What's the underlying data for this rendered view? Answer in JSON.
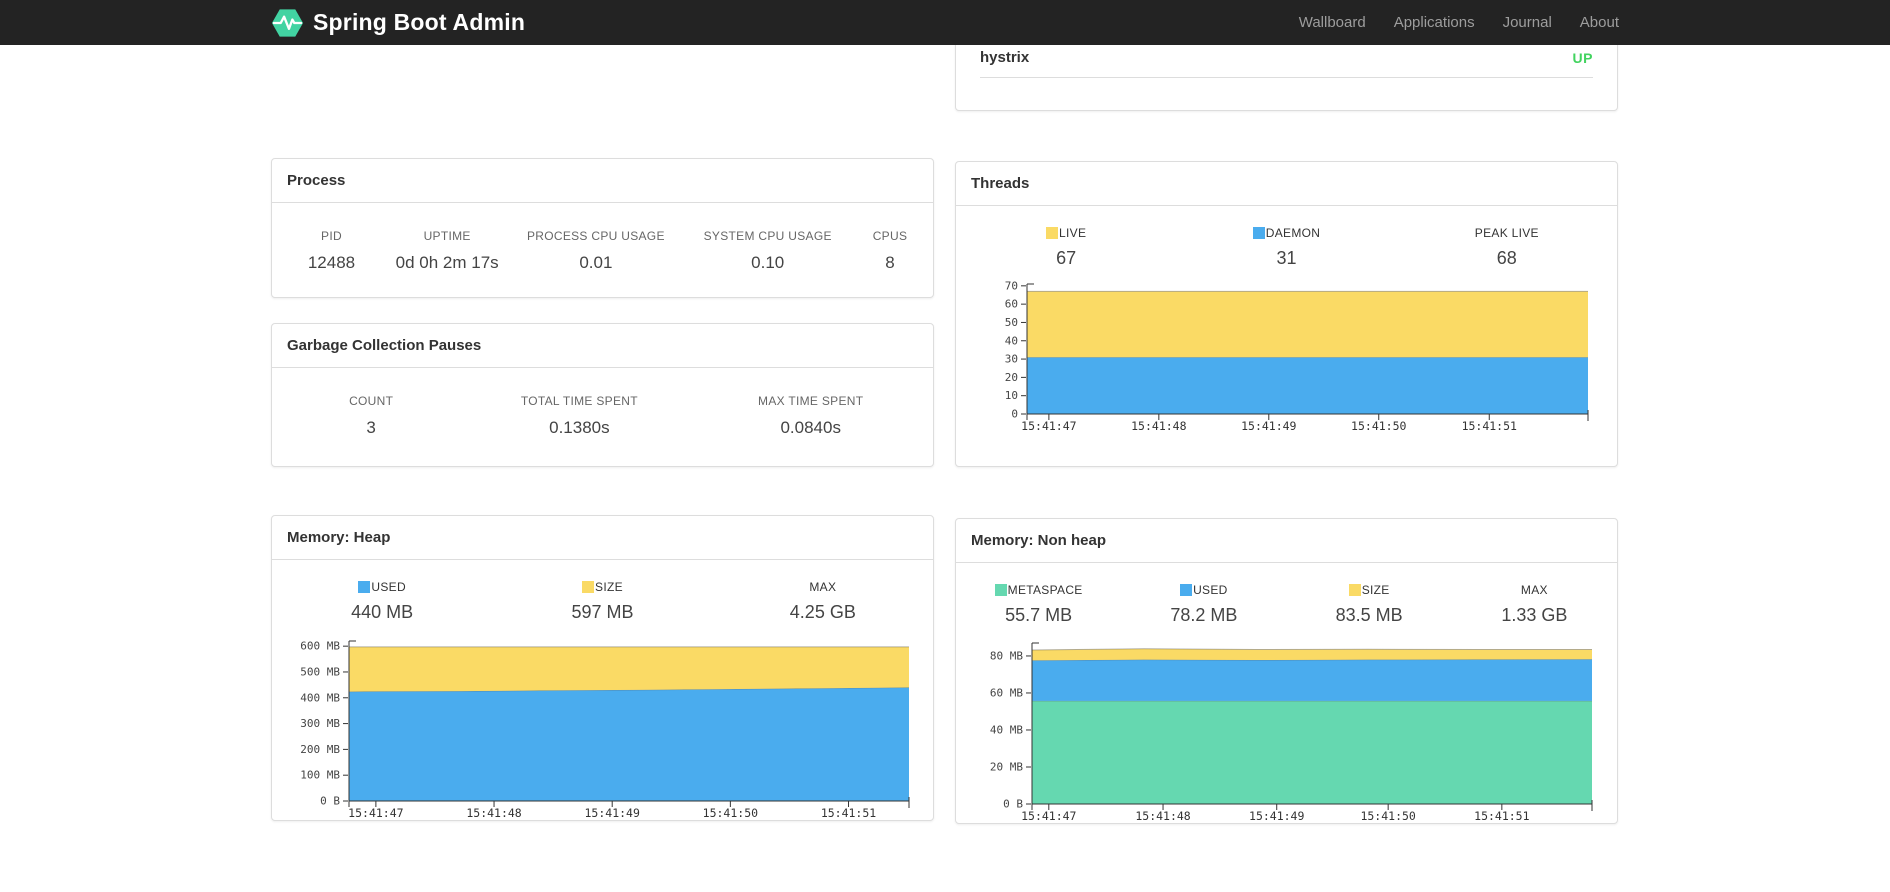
{
  "navbar": {
    "brand": "Spring Boot Admin",
    "links": [
      {
        "label": "Wallboard"
      },
      {
        "label": "Applications"
      },
      {
        "label": "Journal"
      },
      {
        "label": "About"
      }
    ]
  },
  "colors": {
    "navbar_bg": "#232323",
    "brand_green": "#42d3a2",
    "status_up": "#42d35f",
    "chart_yellow": "#fada65",
    "chart_blue": "#4aacee",
    "chart_green": "#65d8b0"
  },
  "application": {
    "name": "hystrix",
    "status": "UP"
  },
  "process": {
    "title": "Process",
    "metrics": [
      {
        "label": "PID",
        "value": "12488"
      },
      {
        "label": "UPTIME",
        "value": "0d 0h 2m 17s"
      },
      {
        "label": "PROCESS CPU USAGE",
        "value": "0.01"
      },
      {
        "label": "SYSTEM CPU USAGE",
        "value": "0.10"
      },
      {
        "label": "CPUS",
        "value": "8"
      }
    ]
  },
  "gc": {
    "title": "Garbage Collection Pauses",
    "metrics": [
      {
        "label": "COUNT",
        "value": "3"
      },
      {
        "label": "TOTAL TIME SPENT",
        "value": "0.1380s"
      },
      {
        "label": "MAX TIME SPENT",
        "value": "0.0840s"
      }
    ]
  },
  "threads": {
    "title": "Threads",
    "legend": [
      {
        "label": "LIVE",
        "color": "#fada65",
        "value": "67"
      },
      {
        "label": "DAEMON",
        "color": "#4aacee",
        "value": "31"
      },
      {
        "label": "PEAK LIVE",
        "color": "",
        "value": "68"
      }
    ]
  },
  "memory_heap": {
    "title": "Memory: Heap",
    "legend": [
      {
        "label": "USED",
        "color": "#4aacee",
        "value": "440 MB"
      },
      {
        "label": "SIZE",
        "color": "#fada65",
        "value": "597 MB"
      },
      {
        "label": "MAX",
        "color": "",
        "value": "4.25 GB"
      }
    ]
  },
  "memory_nonheap": {
    "title": "Memory: Non heap",
    "legend": [
      {
        "label": "METASPACE",
        "color": "#65d8b0",
        "value": "55.7 MB"
      },
      {
        "label": "USED",
        "color": "#4aacee",
        "value": "78.2 MB"
      },
      {
        "label": "SIZE",
        "color": "#fada65",
        "value": "83.5 MB"
      },
      {
        "label": "MAX",
        "color": "",
        "value": "1.33 GB"
      }
    ]
  },
  "chart_data": [
    {
      "id": "threads",
      "type": "area",
      "title": "Threads (stacked: daemon below, live total on top)",
      "x_labels": [
        "15:41:47",
        "15:41:48",
        "15:41:49",
        "15:41:50",
        "15:41:51"
      ],
      "ylim": [
        0,
        71
      ],
      "yticks": [
        {
          "v": 0,
          "label": "0"
        },
        {
          "v": 10,
          "label": "10"
        },
        {
          "v": 20,
          "label": "20"
        },
        {
          "v": 30,
          "label": "30"
        },
        {
          "v": 40,
          "label": "40"
        },
        {
          "v": 50,
          "label": "50"
        },
        {
          "v": 60,
          "label": "60"
        },
        {
          "v": 70,
          "label": "70"
        }
      ],
      "grid": false,
      "legend_position": "top",
      "series": [
        {
          "name": "DAEMON",
          "color": "#4aacee",
          "values": [
            31,
            31,
            31,
            31,
            31,
            31
          ]
        },
        {
          "name": "LIVE",
          "color": "#fada65",
          "values": [
            67,
            67,
            67,
            67,
            67,
            67
          ]
        }
      ]
    },
    {
      "id": "heap",
      "type": "area",
      "title": "Memory: Heap (MB, stacked: used below, size on top)",
      "x_labels": [
        "15:41:47",
        "15:41:48",
        "15:41:49",
        "15:41:50",
        "15:41:51"
      ],
      "ylim": [
        0,
        620
      ],
      "yticks": [
        {
          "v": 0,
          "label": "0 B"
        },
        {
          "v": 100,
          "label": "100 MB"
        },
        {
          "v": 200,
          "label": "200 MB"
        },
        {
          "v": 300,
          "label": "300 MB"
        },
        {
          "v": 400,
          "label": "400 MB"
        },
        {
          "v": 500,
          "label": "500 MB"
        },
        {
          "v": 600,
          "label": "600 MB"
        }
      ],
      "grid": false,
      "legend_position": "top",
      "series": [
        {
          "name": "USED",
          "color": "#4aacee",
          "values": [
            424,
            426,
            429,
            432,
            436,
            440
          ]
        },
        {
          "name": "SIZE",
          "color": "#fada65",
          "values": [
            597,
            597,
            597,
            597,
            597,
            597
          ]
        }
      ]
    },
    {
      "id": "nonheap",
      "type": "area",
      "title": "Memory: Non heap (MB, stacked: metaspace, used, size)",
      "x_labels": [
        "15:41:47",
        "15:41:48",
        "15:41:49",
        "15:41:50",
        "15:41:51"
      ],
      "ylim": [
        0,
        87
      ],
      "yticks": [
        {
          "v": 0,
          "label": "0 B"
        },
        {
          "v": 20,
          "label": "20 MB"
        },
        {
          "v": 40,
          "label": "40 MB"
        },
        {
          "v": 60,
          "label": "60 MB"
        },
        {
          "v": 80,
          "label": "80 MB"
        }
      ],
      "grid": false,
      "legend_position": "top",
      "series": [
        {
          "name": "METASPACE",
          "color": "#65d8b0",
          "values": [
            55.7,
            55.7,
            55.7,
            55.7,
            55.7,
            55.7
          ]
        },
        {
          "name": "USED",
          "color": "#4aacee",
          "values": [
            77.6,
            78.0,
            77.8,
            78.0,
            78.1,
            78.2
          ]
        },
        {
          "name": "SIZE",
          "color": "#fada65",
          "values": [
            83.2,
            83.9,
            83.5,
            83.6,
            83.5,
            83.5
          ]
        }
      ]
    }
  ]
}
